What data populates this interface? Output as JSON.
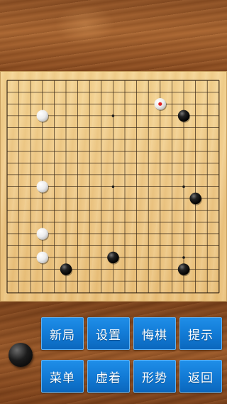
{
  "board": {
    "size": 19,
    "star_points": [
      [
        3,
        3
      ],
      [
        9,
        3
      ],
      [
        15,
        3
      ],
      [
        3,
        9
      ],
      [
        9,
        9
      ],
      [
        15,
        9
      ],
      [
        3,
        15
      ],
      [
        9,
        15
      ],
      [
        15,
        15
      ]
    ],
    "stones": [
      {
        "color": "white",
        "col": 3,
        "row": 3
      },
      {
        "color": "white",
        "col": 3,
        "row": 9
      },
      {
        "color": "white",
        "col": 3,
        "row": 13
      },
      {
        "color": "white",
        "col": 3,
        "row": 15
      },
      {
        "color": "white",
        "col": 13,
        "row": 2,
        "last_move": true
      },
      {
        "color": "black",
        "col": 15,
        "row": 3
      },
      {
        "color": "black",
        "col": 16,
        "row": 10
      },
      {
        "color": "black",
        "col": 9,
        "row": 15
      },
      {
        "color": "black",
        "col": 5,
        "row": 16
      },
      {
        "color": "black",
        "col": 15,
        "row": 16
      }
    ],
    "last_move_marker_color": "#e02020"
  },
  "turn_indicator": {
    "color": "black"
  },
  "buttons": {
    "new_game": "新局",
    "settings": "设置",
    "undo": "悔棋",
    "hint": "提示",
    "menu": "菜单",
    "pass": "虚着",
    "evaluate": "形势",
    "back": "返回"
  },
  "colors": {
    "button_blue": "#127bd6",
    "board_wood": "#eec886",
    "grid_line": "#3a2a18"
  }
}
